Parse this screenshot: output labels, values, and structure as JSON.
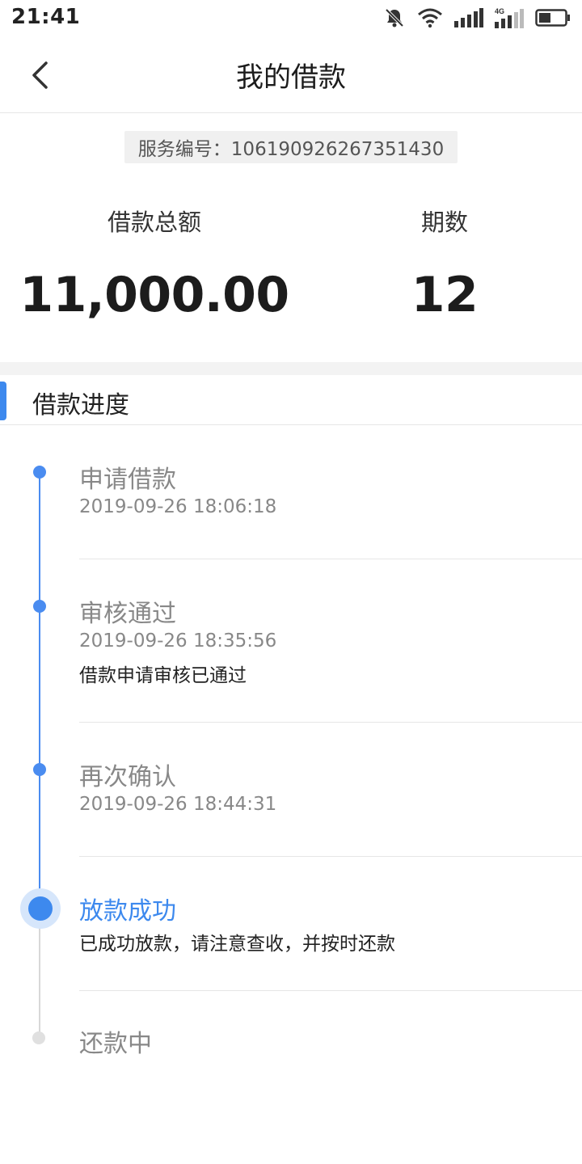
{
  "status_bar": {
    "time": "21:41",
    "icons": [
      "bell-muted-icon",
      "wifi-icon",
      "signal-icon",
      "signal-4g-icon",
      "battery-icon"
    ],
    "network_label": "4G"
  },
  "nav": {
    "title": "我的借款",
    "back_icon": "chevron-left-icon"
  },
  "summary": {
    "service_no": "服务编号：106190926267351430",
    "total_label": "借款总额",
    "total_value": "11,000.00",
    "periods_label": "期数",
    "periods_value": "12"
  },
  "progress": {
    "title": "借款进度",
    "steps": [
      {
        "title": "申请借款",
        "time": "2019-09-26 18:06:18",
        "note": ""
      },
      {
        "title": "审核通过",
        "time": "2019-09-26 18:35:56",
        "note": "借款申请审核已通过"
      },
      {
        "title": "再次确认",
        "time": "2019-09-26 18:44:31",
        "note": ""
      },
      {
        "title": "放款成功",
        "time": "",
        "note": "已成功放款，请注意查收，并按时还款"
      },
      {
        "title": "还款中",
        "time": "",
        "note": ""
      }
    ]
  },
  "colors": {
    "accent": "#3d89ee",
    "inactive": "#e0e0e0",
    "muted_text": "#888888"
  }
}
